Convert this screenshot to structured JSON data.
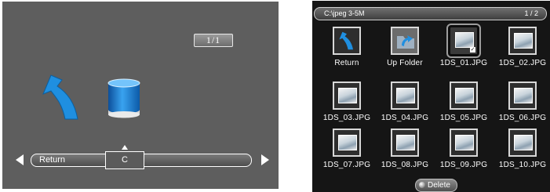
{
  "left_screen": {
    "page_indicator": "1/1",
    "select_bar": {
      "items": [
        {
          "label": "Return"
        },
        {
          "label": "C",
          "selected": true
        }
      ]
    },
    "icons": [
      "return-arrow-icon",
      "drive-icon",
      "arrow-left-icon",
      "arrow-right-icon"
    ]
  },
  "right_screen": {
    "header": {
      "path": "C:\\jpeg 3-5M",
      "page": "1 / 2"
    },
    "tiles": [
      {
        "label": "Return",
        "kind": "return"
      },
      {
        "label": "Up Folder",
        "kind": "folder"
      },
      {
        "label": "1DS_01.JPG",
        "kind": "image",
        "selected": true,
        "checked": true
      },
      {
        "label": "1DS_02.JPG",
        "kind": "image"
      },
      {
        "label": "1DS_03.JPG",
        "kind": "image"
      },
      {
        "label": "1DS_04.JPG",
        "kind": "image"
      },
      {
        "label": "1DS_05.JPG",
        "kind": "image"
      },
      {
        "label": "1DS_06.JPG",
        "kind": "image"
      },
      {
        "label": "1DS_07.JPG",
        "kind": "image"
      },
      {
        "label": "1DS_08.JPG",
        "kind": "image"
      },
      {
        "label": "1DS_09.JPG",
        "kind": "image"
      },
      {
        "label": "1DS_10.JPG",
        "kind": "image"
      }
    ],
    "delete_button": {
      "label": "Delete"
    }
  },
  "colors": {
    "left_background": "#5e5e5e",
    "right_background": "#151515",
    "icon_blue": "#1f8fe0"
  }
}
